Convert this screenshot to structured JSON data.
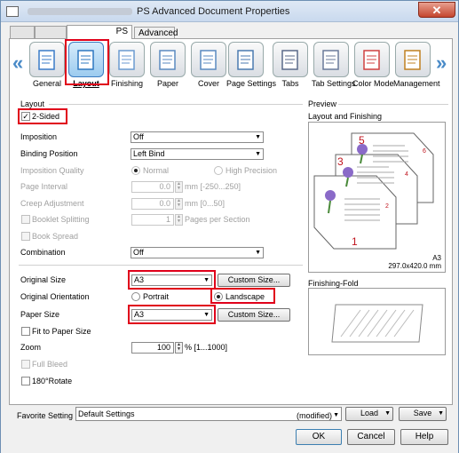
{
  "window": {
    "title": "PS Advanced Document Properties",
    "close": "✕"
  },
  "tabs": {
    "ps": "PS",
    "advanced": "Advanced"
  },
  "iconbar": {
    "items": [
      {
        "label": "General",
        "icon": "general-icon"
      },
      {
        "label": "Layout",
        "icon": "layout-icon",
        "selected": true
      },
      {
        "label": "Finishing",
        "icon": "finishing-icon"
      },
      {
        "label": "Paper",
        "icon": "paper-icon"
      },
      {
        "label": "Cover",
        "icon": "cover-icon"
      },
      {
        "label": "Page Settings",
        "icon": "page-settings-icon"
      },
      {
        "label": "Tabs",
        "icon": "tabs-icon"
      },
      {
        "label": "Tab Settings",
        "icon": "tab-settings-icon"
      },
      {
        "label": "Color Mode",
        "icon": "color-mode-icon"
      },
      {
        "label": "Management",
        "icon": "management-icon"
      }
    ]
  },
  "layout": {
    "group_label": "Layout",
    "two_sided": "2-Sided",
    "imposition_label": "Imposition",
    "imposition_value": "Off",
    "binding_label": "Binding Position",
    "binding_value": "Left Bind",
    "imposition_quality_label": "Imposition Quality",
    "normal": "Normal",
    "high_precision": "High Precision",
    "page_interval_label": "Page Interval",
    "page_interval_value": "0.0",
    "page_interval_unit": "mm [-250...250]",
    "creep_label": "Creep Adjustment",
    "creep_value": "0.0",
    "creep_unit": "mm [0...50]",
    "booklet_splitting": "Booklet Splitting",
    "booklet_value": "1",
    "booklet_unit": "Pages per Section",
    "book_spread": "Book Spread",
    "combination_label": "Combination",
    "combination_value": "Off",
    "original_size_label": "Original Size",
    "original_size_value": "A3",
    "custom_size": "Custom Size...",
    "orientation_label": "Original Orientation",
    "portrait": "Portrait",
    "landscape": "Landscape",
    "paper_size_label": "Paper Size",
    "paper_size_value": "A3",
    "fit_to_paper": "Fit to Paper Size",
    "zoom_label": "Zoom",
    "zoom_value": "100",
    "zoom_unit": "% [1...1000]",
    "full_bleed": "Full Bleed",
    "rotate": "180°Rotate"
  },
  "preview": {
    "group_label": "Preview",
    "layout_finishing": "Layout and Finishing",
    "page_numbers": [
      "5",
      "6",
      "3",
      "4",
      "1",
      "2"
    ],
    "paper_name": "A3",
    "paper_dims": "297.0x420.0 mm",
    "finishing_fold": "Finishing-Fold"
  },
  "footer": {
    "favorite_label": "Favorite Setting",
    "favorite_value": "Default Settings",
    "modified": "(modified)",
    "load": "Load",
    "save": "Save",
    "ok": "OK",
    "cancel": "Cancel",
    "help": "Help"
  },
  "colors": {
    "highlight_red": "#e0001a",
    "accent_blue": "#3b7cc0",
    "page_number_red": "#c0141e"
  }
}
